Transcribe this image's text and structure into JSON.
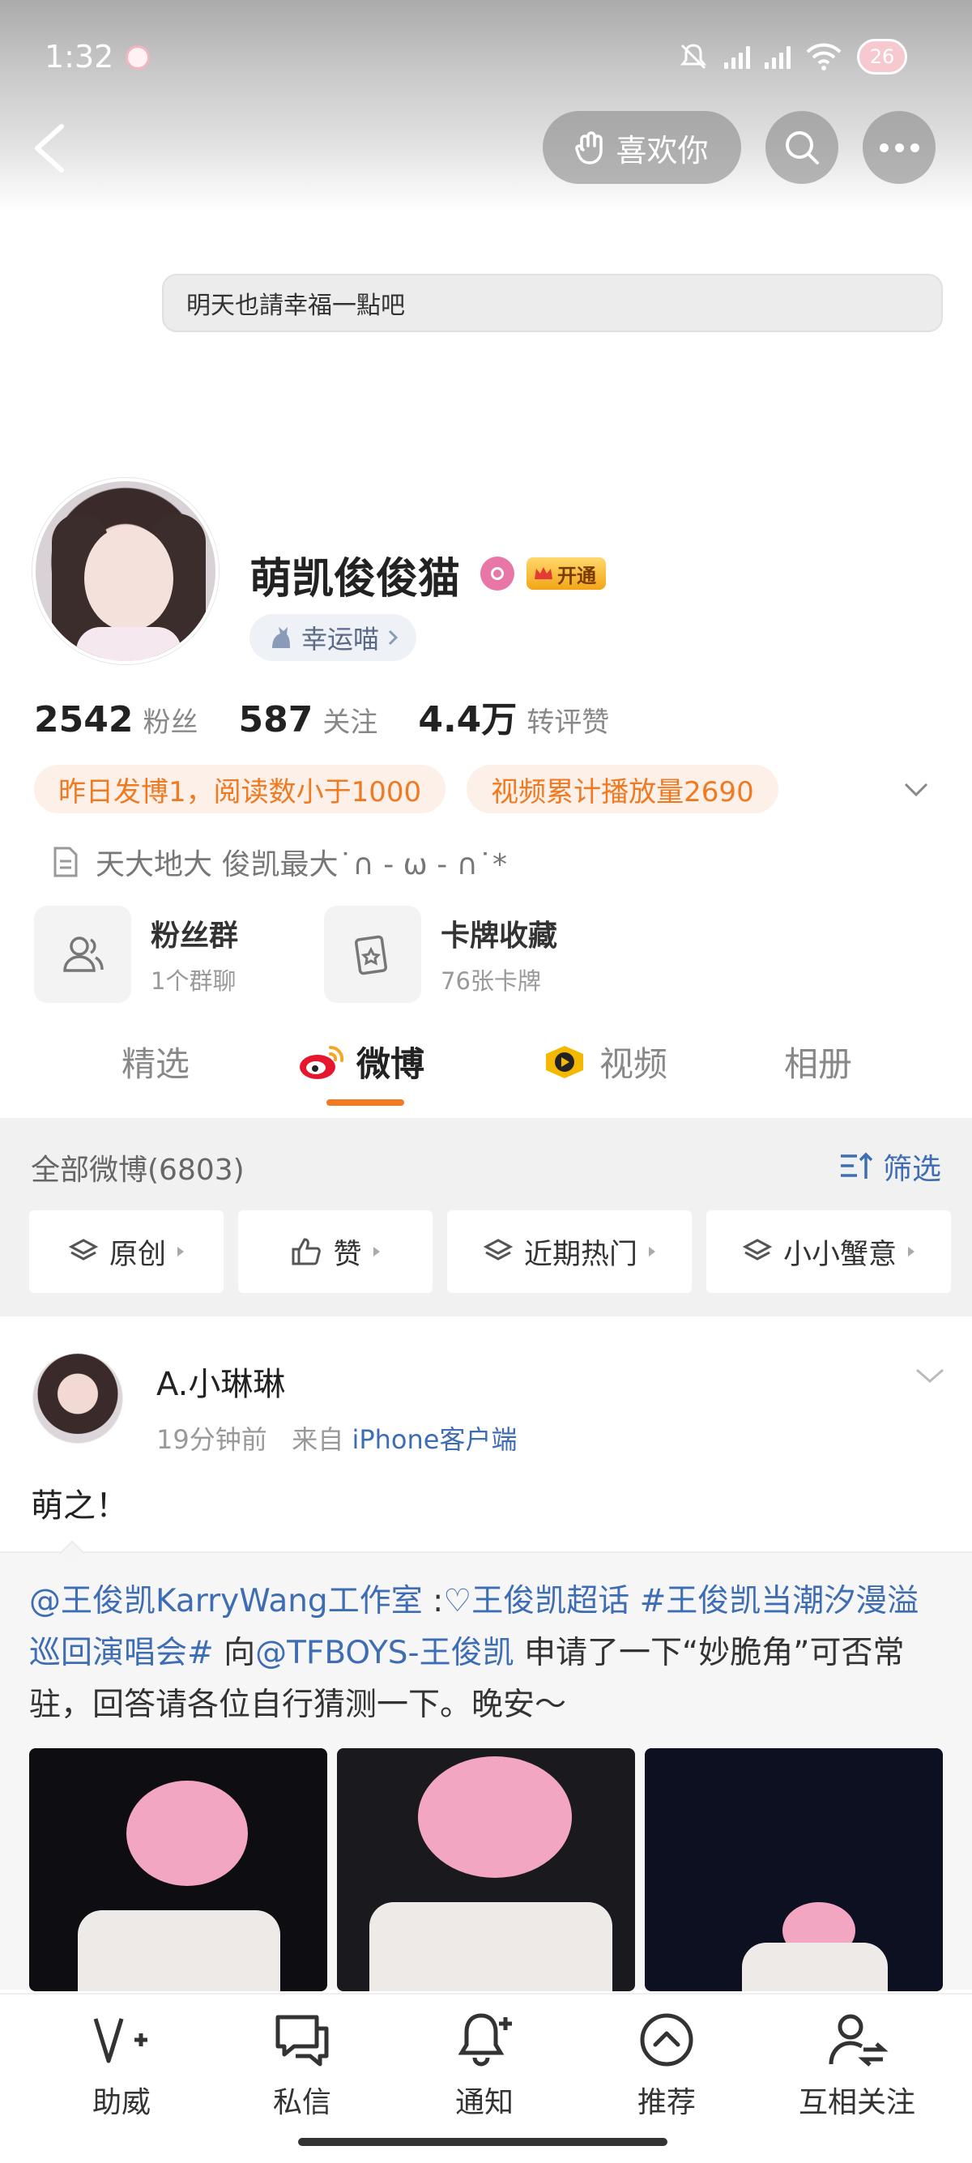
{
  "status_bar": {
    "time": "1:32",
    "battery": "26"
  },
  "top_nav": {
    "like_label": "喜欢你"
  },
  "profile": {
    "signature": "明天也請幸福一點吧",
    "username": "萌凯俊俊猫",
    "vip_label": "开通",
    "lucky_tag": "幸运喵",
    "stats": [
      {
        "num": "2542",
        "label": "粉丝"
      },
      {
        "num": "587",
        "label": "关注"
      },
      {
        "num": "4.4万",
        "label": "转评赞"
      }
    ],
    "highlights": [
      "昨日发博1，阅读数小于1000",
      "视频累计播放量2690"
    ],
    "bio": "天大地大 俊凯最大˙∩ - ω - ∩˙*",
    "cards": [
      {
        "title": "粉丝群",
        "sub": "1个群聊",
        "icon": "group-icon"
      },
      {
        "title": "卡牌收藏",
        "sub": "76张卡牌",
        "icon": "card-collection-icon"
      }
    ]
  },
  "tabs": [
    {
      "label": "精选"
    },
    {
      "label": "微博"
    },
    {
      "label": "视频"
    },
    {
      "label": "相册"
    }
  ],
  "feed": {
    "all_posts": "全部微博(6803)",
    "filter_label": "筛选",
    "chips": [
      "原创",
      "赞",
      "近期热门",
      "小小蟹意"
    ]
  },
  "post": {
    "user": "A.小琳琳",
    "time": "19分钟前",
    "from_label": "来自",
    "source": "iPhone客户端",
    "text": "萌之！",
    "repost_parts": [
      {
        "t": "@王俊凯KarryWang工作室",
        "link": true
      },
      {
        "t": " :",
        "link": false
      },
      {
        "t": "♡王俊凯超话",
        "link": true
      },
      {
        "t": " ",
        "link": false
      },
      {
        "t": "#王俊凯当潮汐漫溢巡回演唱会#",
        "link": true
      },
      {
        "t": " 向",
        "link": false
      },
      {
        "t": "@TFBOYS-王俊凯",
        "link": true
      },
      {
        "t": " 申请了一下“妙脆角”可否常驻，回答请各位自行猜测一下。晚安～",
        "link": false
      }
    ]
  },
  "bottom_nav": [
    {
      "label": "助威",
      "icon": "cheer-icon"
    },
    {
      "label": "私信",
      "icon": "message-icon"
    },
    {
      "label": "通知",
      "icon": "bell-icon"
    },
    {
      "label": "推荐",
      "icon": "recommend-icon"
    },
    {
      "label": "互相关注",
      "icon": "mutual-follow-icon"
    }
  ],
  "colors": {
    "accent": "#f07a22",
    "link": "#3e6db3"
  }
}
